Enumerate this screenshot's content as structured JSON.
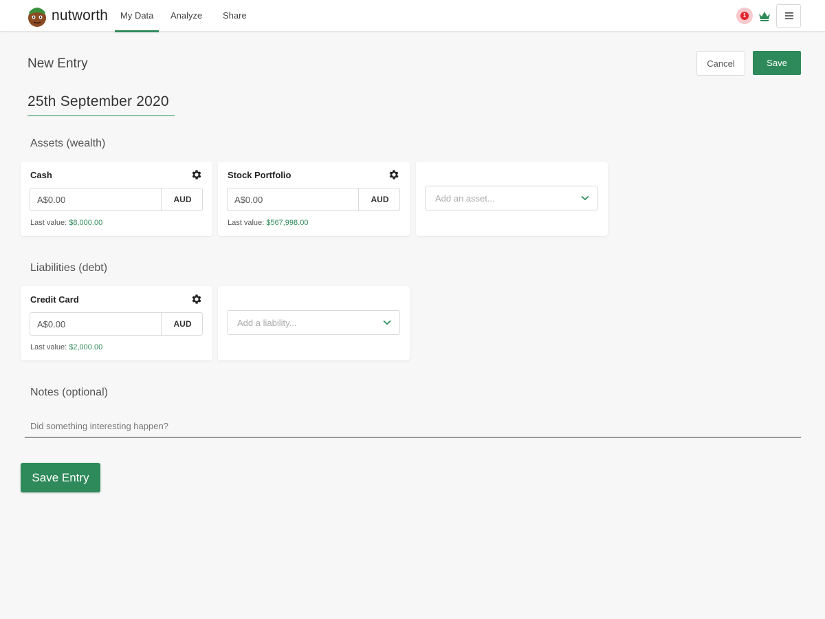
{
  "header": {
    "brand": "nutworth",
    "tabs": [
      {
        "label": "My Data",
        "active": true
      },
      {
        "label": "Analyze",
        "active": false
      },
      {
        "label": "Share",
        "active": false
      }
    ],
    "notification_count": "1",
    "menu_icon": "hamburger-menu-icon",
    "accent_color": "#2e8a5a"
  },
  "page": {
    "title": "New Entry",
    "cancel_label": "Cancel",
    "save_label": "Save",
    "date": "25th September 2020"
  },
  "assets": {
    "title": "Assets (wealth)",
    "items": [
      {
        "name": "Cash",
        "value": "A$0.00",
        "currency": "AUD",
        "last_label": "Last value:",
        "last_value": "$8,000.00"
      },
      {
        "name": "Stock Portfolio",
        "value": "A$0.00",
        "currency": "AUD",
        "last_label": "Last value:",
        "last_value": "$567,998.00"
      }
    ],
    "add_placeholder": "Add an asset..."
  },
  "liabilities": {
    "title": "Liabilities (debt)",
    "items": [
      {
        "name": "Credit Card",
        "value": "A$0.00",
        "currency": "AUD",
        "last_label": "Last value:",
        "last_value": "$2,000.00"
      }
    ],
    "add_placeholder": "Add a liability..."
  },
  "notes": {
    "title": "Notes (optional)",
    "placeholder": "Did something interesting happen?"
  },
  "save_entry_label": "Save Entry"
}
